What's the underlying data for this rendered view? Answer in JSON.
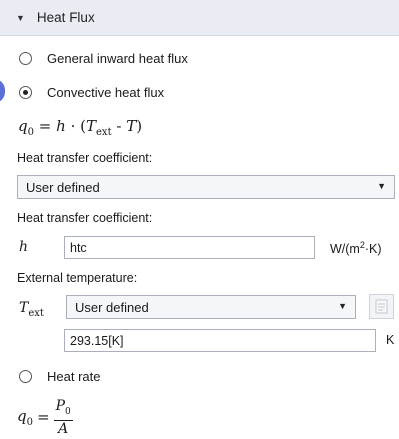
{
  "section": {
    "title": "Heat Flux"
  },
  "options": [
    {
      "label": "General inward heat flux",
      "checked": false
    },
    {
      "label": "Convective heat flux",
      "checked": true
    },
    {
      "label": "Heat rate",
      "checked": false
    }
  ],
  "convective": {
    "formula": {
      "lhs": "q",
      "lhs_sub": "0",
      "eq": "=",
      "h": "h",
      "dot": "·",
      "open": "(",
      "T_ext": "T",
      "T_ext_sub": "ext",
      "minus": "-",
      "T": "T",
      "close": ")"
    },
    "htc_mode_label": "Heat transfer coefficient:",
    "htc_mode_value": "User defined",
    "htc_label": "Heat transfer coefficient:",
    "htc_symbol": "h",
    "htc_value": "htc",
    "htc_unit_prefix": "W/(m",
    "htc_unit_sup": "2",
    "htc_unit_suffix": "·K)",
    "ext_temp_label": "External temperature:",
    "ext_symbol": "T",
    "ext_symbol_sub": "ext",
    "ext_mode_value": "User defined",
    "ext_value": "293.15[K]",
    "ext_unit": "K"
  },
  "heat_rate_formula": {
    "lhs": "q",
    "lhs_sub": "0",
    "eq": "=",
    "num": "P",
    "num_sub": "0",
    "den": "A"
  },
  "icons": {
    "caret": "triangle-down",
    "dropdown": "triangle-down",
    "side_button": "document-icon"
  }
}
